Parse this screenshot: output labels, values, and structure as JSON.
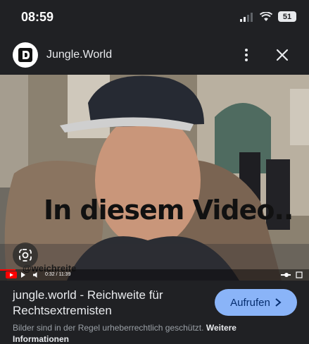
{
  "status_bar": {
    "time": "08:59",
    "battery": "51"
  },
  "header": {
    "site_name": "Jungle.World",
    "logo_icon": "jungle-world-logo",
    "more_icon": "more-vert-icon",
    "close_icon": "close-icon"
  },
  "image": {
    "overlay_text": "In diesem Video..",
    "watermark": "@weichreite",
    "player_time": "0:32 / 11:39"
  },
  "result": {
    "title": "jungle.world - Reichweite für Rechtsextremisten",
    "visit_label": "Aufrufen",
    "copyright": "Bilder sind in der Regel urheberrechtlich geschützt.",
    "learn_more": "Weitere",
    "learn_more_cont": "Informationen"
  },
  "colors": {
    "background": "#202124",
    "accent": "#8ab4f8"
  }
}
